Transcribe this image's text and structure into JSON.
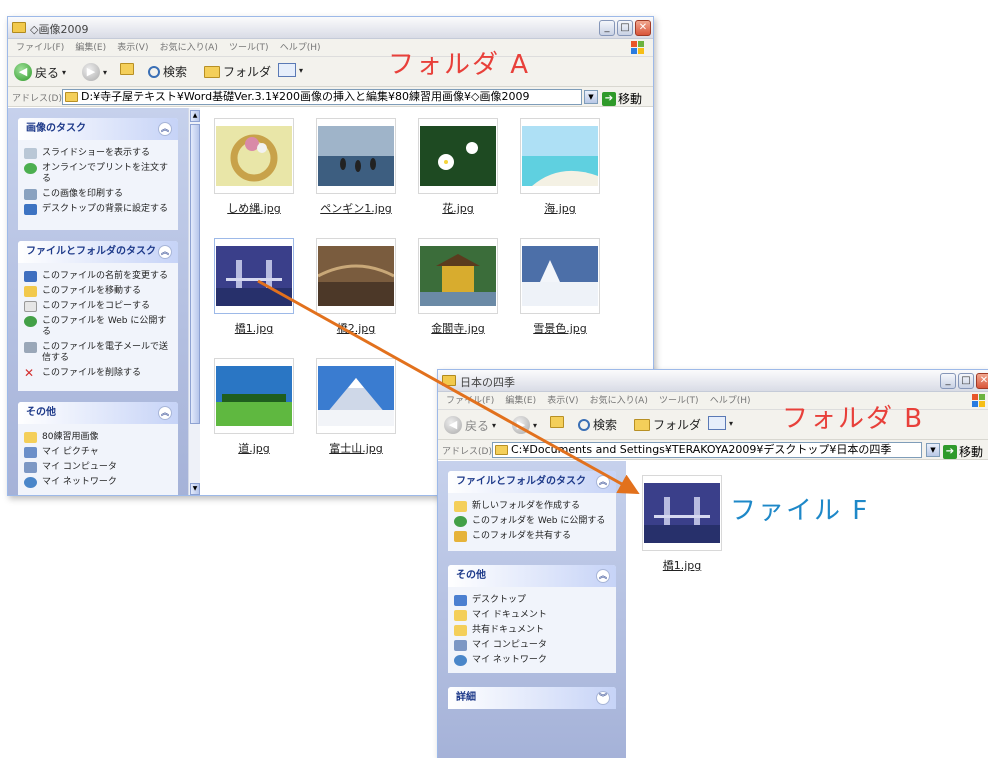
{
  "windowA": {
    "title": "◇画像2009",
    "menu": [
      "ファイル(F)",
      "編集(E)",
      "表示(V)",
      "お気に入り(A)",
      "ツール(T)",
      "ヘルプ(H)"
    ],
    "toolbar": {
      "back": "戻る",
      "search": "検索",
      "folders": "フォルダ"
    },
    "address_label": "アドレス(D)",
    "address": "D:¥寺子屋テキスト¥Word基礎Ver.3.1¥200画像の挿入と編集¥80練習用画像¥◇画像2009",
    "go": "移動",
    "panels": [
      {
        "title": "画像のタスク",
        "chevron": "︽",
        "items": [
          "スライドショーを表示する",
          "オンラインでプリントを注文する",
          "この画像を印刷する",
          "デスクトップの背景に設定する"
        ]
      },
      {
        "title": "ファイルとフォルダのタスク",
        "chevron": "︽",
        "items": [
          "このファイルの名前を変更する",
          "このファイルを移動する",
          "このファイルをコピーする",
          "このファイルを Web に公開する",
          "このファイルを電子メールで送信する",
          "このファイルを削除する"
        ]
      },
      {
        "title": "その他",
        "chevron": "︽",
        "items": [
          "80練習用画像",
          "マイ ピクチャ",
          "マイ コンピュータ",
          "マイ ネットワーク"
        ]
      }
    ],
    "files": [
      "しめ縄.jpg",
      "ペンギン1.jpg",
      "花.jpg",
      "海.jpg",
      "橋1.jpg",
      "橋2.jpg",
      "金閣寺.jpg",
      "雪景色.jpg",
      "道.jpg",
      "富士山.jpg"
    ]
  },
  "windowB": {
    "title": "日本の四季",
    "menu": [
      "ファイル(F)",
      "編集(E)",
      "表示(V)",
      "お気に入り(A)",
      "ツール(T)",
      "ヘルプ(H)"
    ],
    "toolbar": {
      "back": "戻る",
      "search": "検索",
      "folders": "フォルダ"
    },
    "address_label": "アドレス(D)",
    "address": "C:¥Documents and Settings¥TERAKOYA2009¥デスクトップ¥日本の四季",
    "go": "移動",
    "panels": [
      {
        "title": "ファイルとフォルダのタスク",
        "chevron": "︽",
        "items": [
          "新しいフォルダを作成する",
          "このフォルダを Web に公開する",
          "このフォルダを共有する"
        ]
      },
      {
        "title": "その他",
        "chevron": "︽",
        "items": [
          "デスクトップ",
          "マイ ドキュメント",
          "共有ドキュメント",
          "マイ コンピュータ",
          "マイ ネットワーク"
        ]
      },
      {
        "title": "詳細",
        "chevron": "︾",
        "items": []
      }
    ],
    "files": [
      "橋1.jpg"
    ]
  },
  "annotations": {
    "folderA": "フォルダ A",
    "folderB": "フォルダ B",
    "fileF": "ファイル F"
  },
  "colors": {
    "annotation_red": "#e8403a",
    "annotation_blue": "#1e88c8",
    "arrow": "#e2711d"
  }
}
